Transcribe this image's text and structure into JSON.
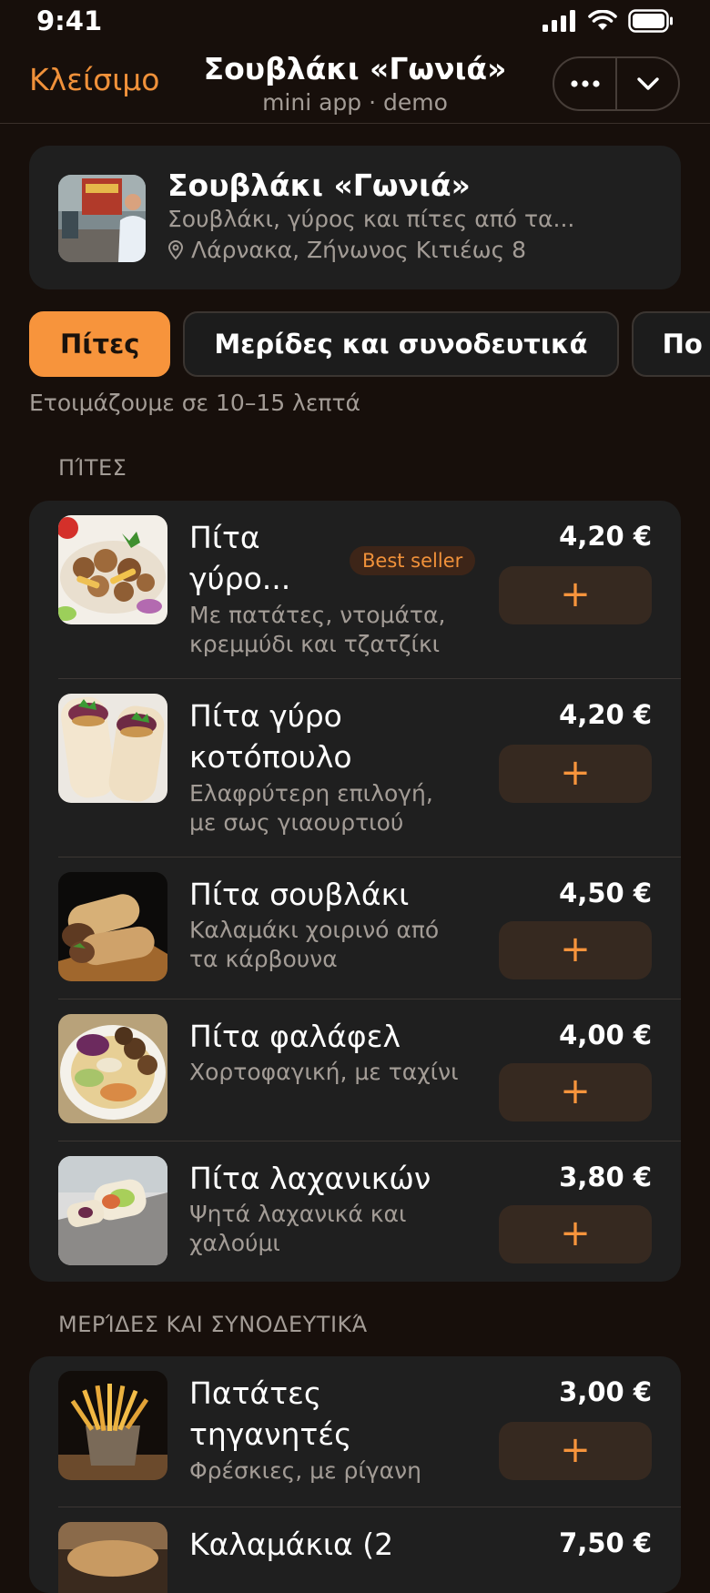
{
  "status": {
    "time": "9:41"
  },
  "header": {
    "close_label": "Κλείσιμο",
    "title": "Σουβλάκι «Γωνιά»",
    "subtitle": "mini app · demo",
    "more_label": "•••"
  },
  "restaurant": {
    "name": "Σουβλάκι «Γωνιά»",
    "description": "Σουβλάκι, γύρος και πίτες από τα...",
    "address": "Λάρνακα, Ζήνωνος Κιτιέως 8"
  },
  "tabs": [
    {
      "label": "Πίτες"
    },
    {
      "label": "Μερίδες και συνοδευτικά"
    },
    {
      "label": "Πο"
    }
  ],
  "eta": "Ετοιμάζουμε σε 10–15 λεπτά",
  "sections": [
    {
      "title": "ΠΊΤΕΣ",
      "items": [
        {
          "name_line1": "Πίτα",
          "name_line2": "γύρο...",
          "badge": "Best seller",
          "description_line1": "Με πατάτες, ντομάτα,",
          "description_line2": "κρεμμύδι και τζατζίκι",
          "price": "4,20 €"
        },
        {
          "name_line1": "Πίτα γύρο",
          "name_line2": "κοτόπουλο",
          "description_line1": "Ελαφρύτερη επιλογή,",
          "description_line2": "με σως γιαουρτιού",
          "price": "4,20 €"
        },
        {
          "name_line1": "Πίτα σουβλάκι",
          "description_line1": "Καλαμάκι χοιρινό από",
          "description_line2": "τα κάρβουνα",
          "price": "4,50 €"
        },
        {
          "name_line1": "Πίτα φαλάφελ",
          "description_line1": "Χορτοφαγική, με ταχίνι",
          "price": "4,00 €"
        },
        {
          "name_line1": "Πίτα λαχανικών",
          "description_line1": "Ψητά λαχανικά και",
          "description_line2": "χαλούμι",
          "price": "3,80 €"
        }
      ]
    },
    {
      "title": "ΜΕΡΊΔΕΣ ΚΑΙ ΣΥΝΟΔΕΥΤΙΚΆ",
      "items": [
        {
          "name_line1": "Πατάτες",
          "name_line2": "τηγανητές",
          "description_line1": "Φρέσκιες, με ρίγανη",
          "price": "3,00 €"
        },
        {
          "name_line1": "Καλαμάκια (2",
          "price": "7,50 €"
        }
      ]
    }
  ],
  "add_label": "+",
  "colors": {
    "accent": "#f7943c",
    "background": "#170f0b",
    "card": "#1f1f1f",
    "muted_text": "#a39c96"
  }
}
